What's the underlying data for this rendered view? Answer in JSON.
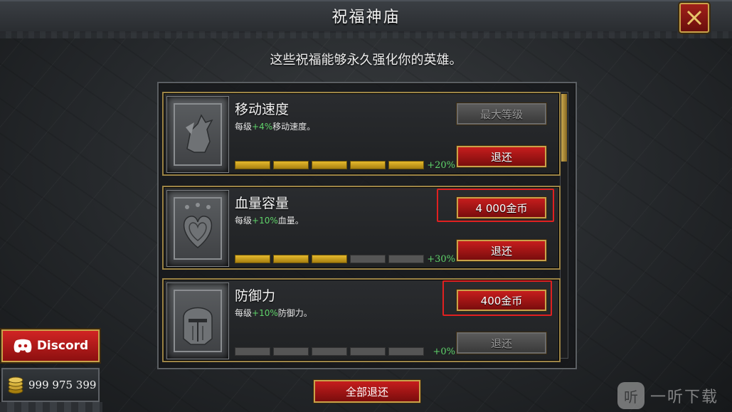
{
  "header": {
    "title": "祝福神庙",
    "close_icon": "close-x-icon"
  },
  "subtitle": "这些祝福能够永久强化你的英雄。",
  "blessings": [
    {
      "name": "移动速度",
      "desc_prefix": "每级",
      "desc_value": "+4%",
      "desc_suffix": "移动速度。",
      "levels_total": 5,
      "levels_filled": 5,
      "bonus": "+20%",
      "top_button": "最大等级",
      "top_button_enabled": false,
      "reset_button": "退还",
      "reset_enabled": true,
      "icon": "pegasus-icon"
    },
    {
      "name": "血量容量",
      "desc_prefix": "每级",
      "desc_value": "+10%",
      "desc_suffix": "血量。",
      "levels_total": 5,
      "levels_filled": 3,
      "bonus": "+30%",
      "top_button": "4 000金币",
      "top_button_enabled": true,
      "reset_button": "退还",
      "reset_enabled": true,
      "icon": "heart-icon"
    },
    {
      "name": "防御力",
      "desc_prefix": "每级",
      "desc_value": "+10%",
      "desc_suffix": "防御力。",
      "levels_total": 5,
      "levels_filled": 0,
      "bonus": "+0%",
      "top_button": "400金币",
      "top_button_enabled": true,
      "reset_button": "退还",
      "reset_enabled": false,
      "icon": "helmet-icon"
    }
  ],
  "footer": {
    "reset_all": "全部退还",
    "discord_label": "Discord",
    "gold_amount": "999 975 399"
  },
  "watermark": {
    "logo_char": "听",
    "text": "一听下载"
  },
  "colors": {
    "accent_red": "#c61d1d",
    "gold_border": "#c9a24a",
    "bonus_green": "#5fd36a",
    "bar_gold": "#e5b92d"
  }
}
